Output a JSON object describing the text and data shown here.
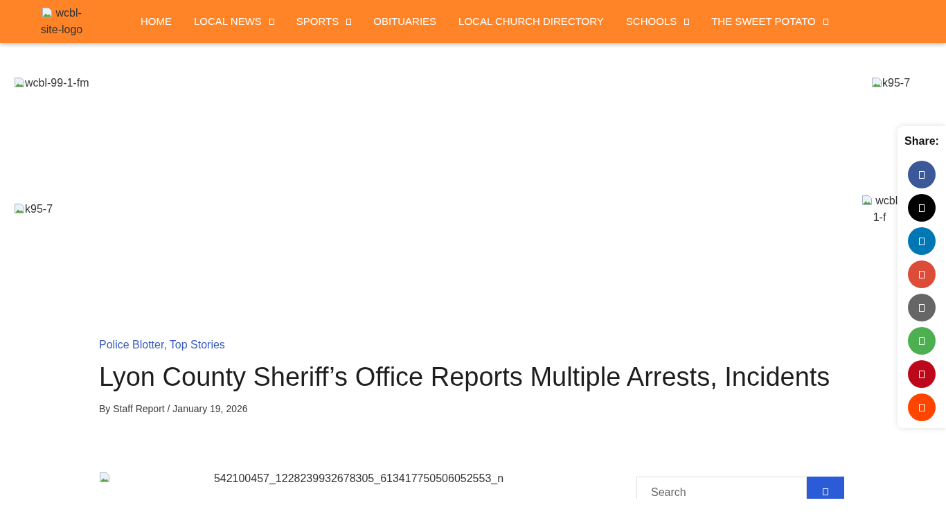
{
  "header": {
    "logo": {
      "alt": "wcbl-site-logo"
    },
    "nav": [
      {
        "label": "HOME",
        "dropdown": false
      },
      {
        "label": "LOCAL NEWS",
        "dropdown": true
      },
      {
        "label": "SPORTS",
        "dropdown": true
      },
      {
        "label": "OBITUARIES",
        "dropdown": false
      },
      {
        "label": "LOCAL CHURCH DIRECTORY",
        "dropdown": false
      },
      {
        "label": "SCHOOLS",
        "dropdown": true
      },
      {
        "label": "THE SWEET POTATO",
        "dropdown": true
      }
    ]
  },
  "ads": {
    "left": [
      {
        "alt": "wcbl-99-1-fm"
      },
      {
        "alt": "k95-7"
      }
    ],
    "right": [
      {
        "alt": "k95-7"
      },
      {
        "alt_lines": [
          "wcbl",
          "1-f"
        ]
      }
    ]
  },
  "share": {
    "title": "Share:",
    "buttons": [
      {
        "color": "#3b5998"
      },
      {
        "color": "#000000"
      },
      {
        "color": "#0077b5"
      },
      {
        "color": "#dd4b39"
      },
      {
        "color": "#666666"
      },
      {
        "color": "#4caf50"
      },
      {
        "color": "#bd081c"
      },
      {
        "color": "#ff4500"
      }
    ]
  },
  "article": {
    "categories": [
      "Police Blotter,",
      "Top Stories"
    ],
    "title": "Lyon County Sheriff’s Office Reports Multiple Arrests, Incidents",
    "meta": "By Staff Report / January 19, 2026"
  },
  "featured_image": {
    "alt": "542100457_1228239932678305_613417750506052553_n"
  },
  "search": {
    "placeholder": "Search"
  }
}
